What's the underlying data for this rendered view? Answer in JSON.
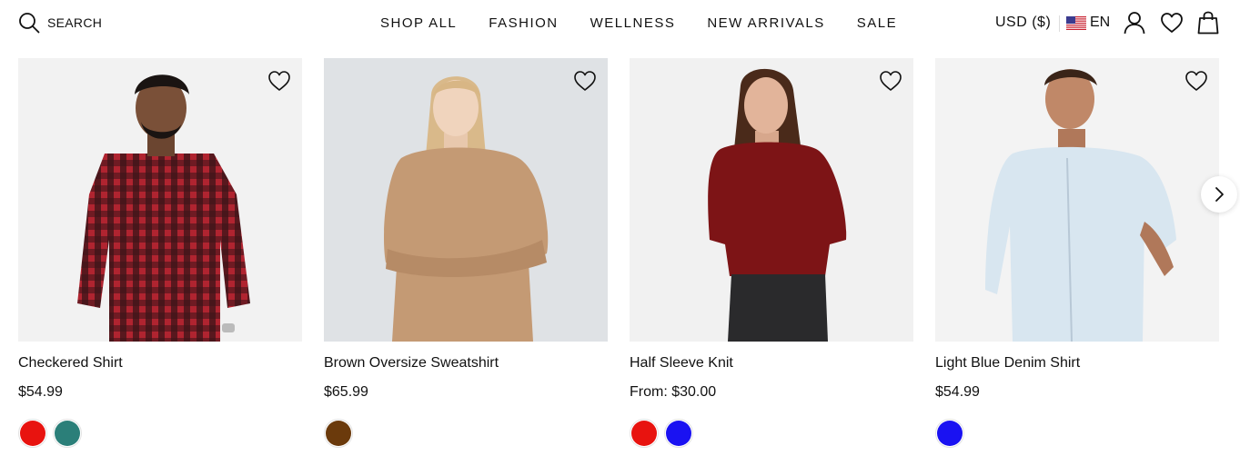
{
  "header": {
    "search_label": "SEARCH",
    "nav": [
      "SHOP ALL",
      "FASHION",
      "WELLNESS",
      "NEW ARRIVALS",
      "SALE"
    ],
    "currency": "USD ($)",
    "language": "EN"
  },
  "products": [
    {
      "name": "Checkered Shirt",
      "price": "$54.99",
      "image_icon": "man-checkered-shirt",
      "bg": "#f2f2f2",
      "swatches": [
        "#e8130f",
        "#2b7f79"
      ]
    },
    {
      "name": "Brown Oversize Sweatshirt",
      "price": "$65.99",
      "image_icon": "woman-brown-sweatshirt",
      "bg": "#dfe2e5",
      "swatches": [
        "#6b3a0c"
      ]
    },
    {
      "name": "Half Sleeve Knit",
      "price": "From: $30.00",
      "image_icon": "woman-red-knit",
      "bg": "#f1f1f1",
      "swatches": [
        "#e8130f",
        "#1a12f2"
      ]
    },
    {
      "name": "Light Blue Denim Shirt",
      "price": "$54.99",
      "image_icon": "man-light-blue-shirt",
      "bg": "#f3f3f3",
      "swatches": [
        "#1a12f2"
      ]
    }
  ],
  "icons": {
    "search": "search-icon",
    "flag": "us-flag-icon",
    "account": "user-icon",
    "wishlist": "heart-icon",
    "cart": "bag-icon",
    "next": "chevron-right-icon"
  }
}
